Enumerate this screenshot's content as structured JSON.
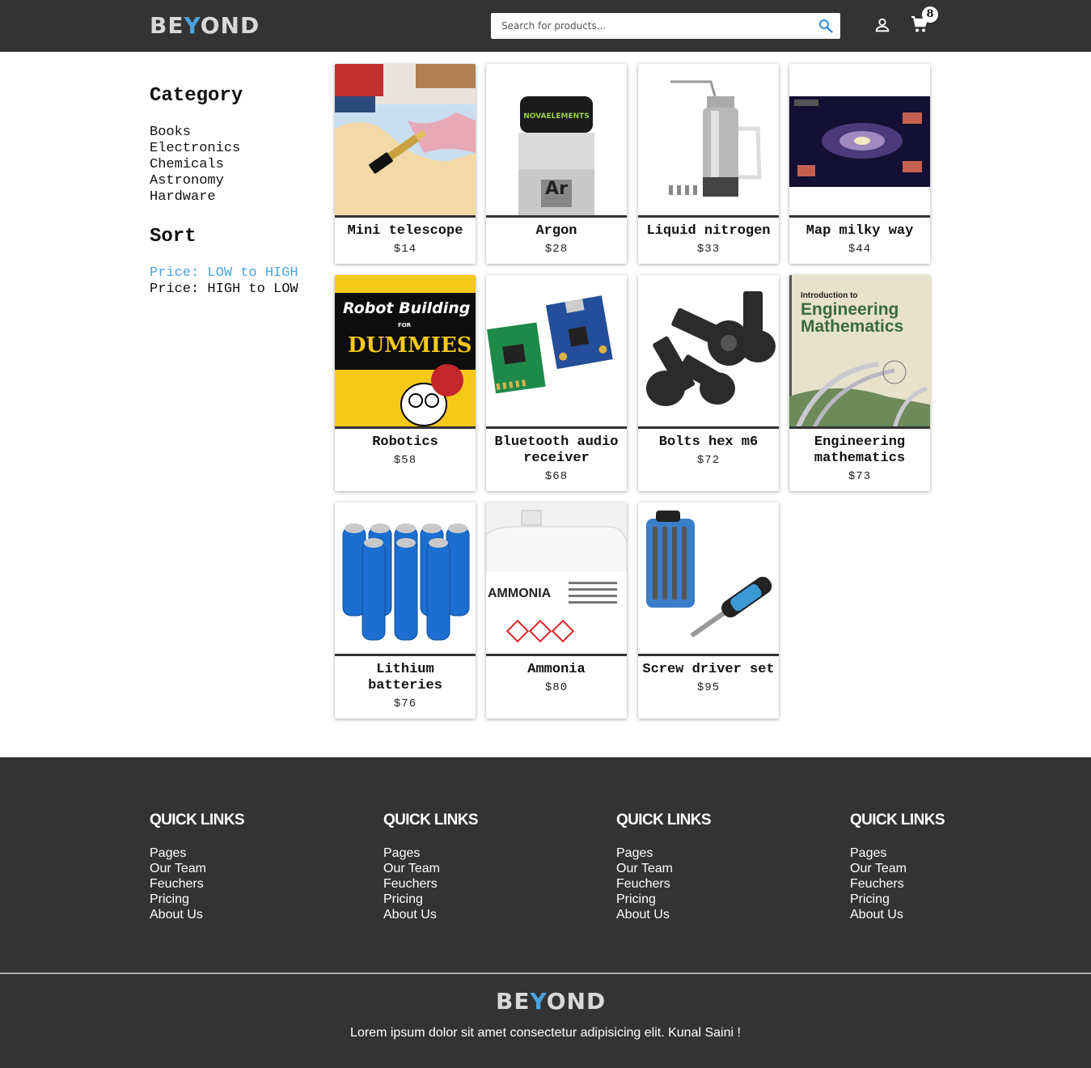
{
  "header": {
    "logo": {
      "text_a": "BE",
      "text_b": "Y",
      "text_c": "OND"
    },
    "search": {
      "placeholder": "Search for products..."
    },
    "cart_count": "8"
  },
  "sidebar": {
    "category_heading": "Category",
    "categories": [
      "Books",
      "Electronics",
      "Chemicals",
      "Astronomy",
      "Hardware"
    ],
    "sort_heading": "Sort",
    "sort_options": [
      "Price: LOW to HIGH",
      "Price: HIGH to LOW"
    ],
    "active_sort": 0
  },
  "products": [
    {
      "name": "Mini telescope",
      "price": "$14",
      "image": "telescope-on-map"
    },
    {
      "name": "Argon",
      "price": "$28",
      "image": "argon-vial"
    },
    {
      "name": "Liquid nitrogen",
      "price": "$33",
      "image": "nitrogen-canister"
    },
    {
      "name": "Map milky way",
      "price": "$44",
      "image": "milky-way-map"
    },
    {
      "name": "Robotics",
      "price": "$58",
      "image": "robot-building-dummies-book"
    },
    {
      "name": "Bluetooth audio receiver",
      "price": "$68",
      "image": "circuit-boards"
    },
    {
      "name": "Bolts hex m6",
      "price": "$72",
      "image": "hex-bolts"
    },
    {
      "name": "Engineering mathematics",
      "price": "$73",
      "image": "engineering-math-book"
    },
    {
      "name": "Lithium batteries",
      "price": "$76",
      "image": "blue-cells"
    },
    {
      "name": "Ammonia",
      "price": "$80",
      "image": "ammonia-jug"
    },
    {
      "name": "Screw driver set",
      "price": "$95",
      "image": "screwdriver-set"
    }
  ],
  "book_covers": {
    "dummies_title": "Robot Building",
    "dummies_sub": "FOR",
    "dummies_brand": "DUMMIES",
    "eng_title_a": "Introduction to",
    "eng_title_b": "Engineering",
    "eng_title_c": "Mathematics",
    "ammonia_label": "AMMONIA",
    "argon_symbol": "Ar"
  },
  "footer": {
    "columns": [
      {
        "heading": "QUICK LINKS",
        "links": [
          "Pages",
          "Our Team",
          "Feuchers",
          "Pricing",
          "About Us"
        ]
      },
      {
        "heading": "QUICK LINKS",
        "links": [
          "Pages",
          "Our Team",
          "Feuchers",
          "Pricing",
          "About Us"
        ]
      },
      {
        "heading": "QUICK LINKS",
        "links": [
          "Pages",
          "Our Team",
          "Feuchers",
          "Pricing",
          "About Us"
        ]
      },
      {
        "heading": "QUICK LINKS",
        "links": [
          "Pages",
          "Our Team",
          "Feuchers",
          "Pricing",
          "About Us"
        ]
      }
    ],
    "tagline": "Lorem ipsum dolor sit amet consectetur adipisicing elit. Kunal Saini !"
  },
  "colors": {
    "header_bg": "#333333",
    "accent": "#4aa3df",
    "footer_bg": "#333333"
  }
}
